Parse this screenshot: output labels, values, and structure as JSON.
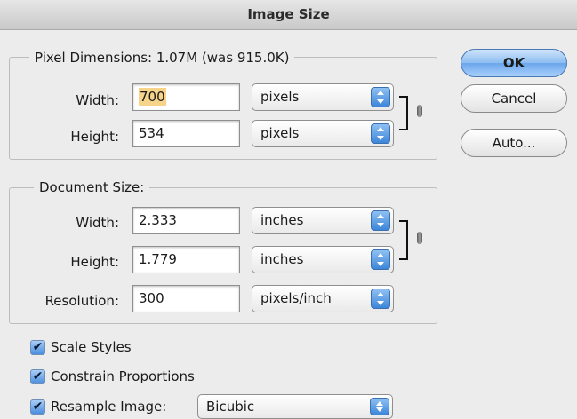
{
  "window": {
    "title": "Image Size"
  },
  "pixel_dimensions": {
    "legend": "Pixel Dimensions:  1.07M (was 915.0K)",
    "width": {
      "label": "Width:",
      "value": "700",
      "unit": "pixels"
    },
    "height": {
      "label": "Height:",
      "value": "534",
      "unit": "pixels"
    }
  },
  "document_size": {
    "legend": "Document Size:",
    "width": {
      "label": "Width:",
      "value": "2.333",
      "unit": "inches"
    },
    "height": {
      "label": "Height:",
      "value": "1.779",
      "unit": "inches"
    },
    "resolution": {
      "label": "Resolution:",
      "value": "300",
      "unit": "pixels/inch"
    }
  },
  "buttons": {
    "ok": "OK",
    "cancel": "Cancel",
    "auto": "Auto..."
  },
  "options": {
    "scale_styles": {
      "label": "Scale Styles",
      "checked": true
    },
    "constrain_proportions": {
      "label": "Constrain Proportions",
      "checked": true
    },
    "resample_image": {
      "label": "Resample Image:",
      "checked": true,
      "method": "Bicubic"
    }
  },
  "colors": {
    "accent": "#4b8ede",
    "field_highlight": "#f6d58a"
  },
  "icons": {
    "link": "chain-link-icon",
    "popup_arrows": "up-down-arrows-icon",
    "checkmark": "checkmark-icon"
  }
}
